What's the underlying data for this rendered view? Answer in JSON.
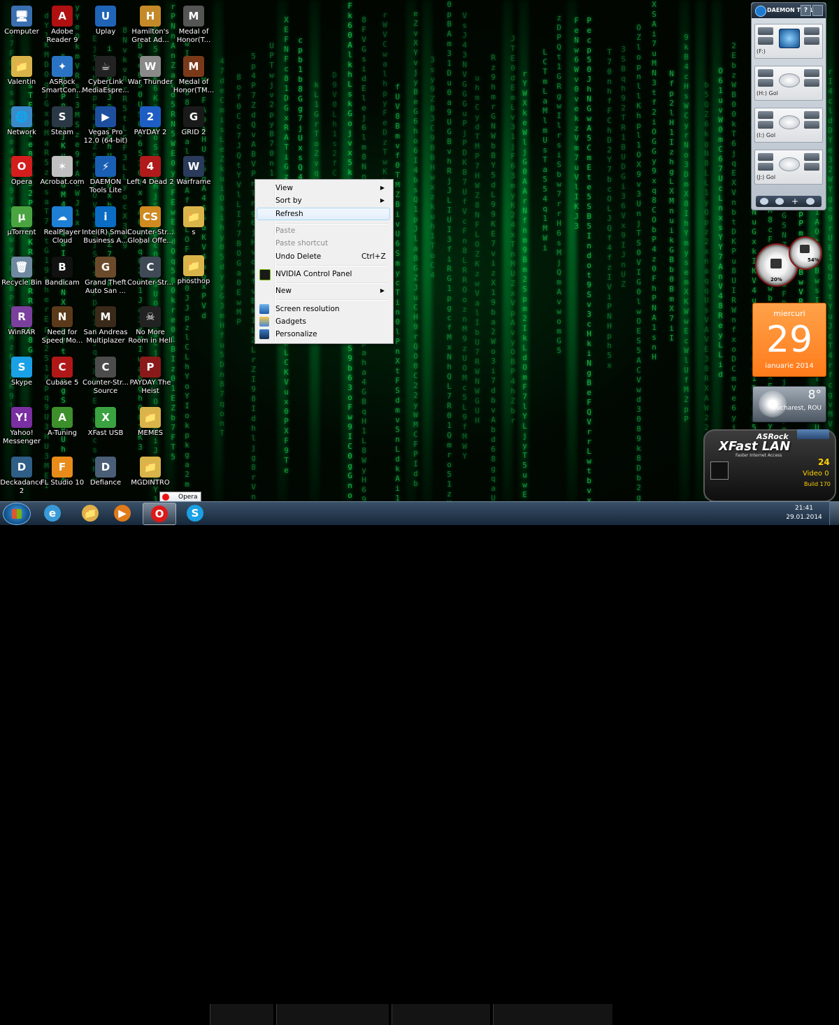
{
  "desktop": {
    "icons": [
      {
        "label": "Computer",
        "glyph": "🖥",
        "color": "#3a6fb0"
      },
      {
        "label": "Valentin",
        "glyph": "📁",
        "color": "#d9b44a"
      },
      {
        "label": "Network",
        "glyph": "🌐",
        "color": "#3a8ac9"
      },
      {
        "label": "Opera",
        "glyph": "O",
        "color": "#d41d1d"
      },
      {
        "label": "µTorrent",
        "glyph": "µ",
        "color": "#4aa540"
      },
      {
        "label": "Recycle Bin",
        "glyph": "🗑",
        "color": "#6f8aa0"
      },
      {
        "label": "WinRAR",
        "glyph": "R",
        "color": "#7b3f9e"
      },
      {
        "label": "Skype",
        "glyph": "S",
        "color": "#1aa0e6"
      },
      {
        "label": "Yahoo! Messenger",
        "glyph": "Y!",
        "color": "#7a2fa2"
      },
      {
        "label": "Deckadance 2",
        "glyph": "D",
        "color": "#2f5e86"
      },
      {
        "label": "Adobe Reader 9",
        "glyph": "A",
        "color": "#b01010"
      },
      {
        "label": "ASRock SmartCon...",
        "glyph": "✦",
        "color": "#2a73c4"
      },
      {
        "label": "Steam",
        "glyph": "S",
        "color": "#2a3745"
      },
      {
        "label": "Acrobat.com",
        "glyph": "✶",
        "color": "#c0c0c0"
      },
      {
        "label": "RealPlayer Cloud",
        "glyph": "☁",
        "color": "#1e7fd4"
      },
      {
        "label": "Bandicam",
        "glyph": "B",
        "color": "#111111"
      },
      {
        "label": "Need for Speed Mo...",
        "glyph": "N",
        "color": "#5a3a1a"
      },
      {
        "label": "Cubase 5",
        "glyph": "C",
        "color": "#b01818"
      },
      {
        "label": "A-Tuning",
        "glyph": "A",
        "color": "#3c8f2a"
      },
      {
        "label": "FL Studio 10",
        "glyph": "F",
        "color": "#e88b1a"
      },
      {
        "label": "Uplay",
        "glyph": "U",
        "color": "#1f64b6"
      },
      {
        "label": "CyberLink MediaEspre...",
        "glyph": "☕",
        "color": "#222222"
      },
      {
        "label": "Vegas Pro 12.0 (64-bit)",
        "glyph": "▶",
        "color": "#1d4f9e"
      },
      {
        "label": "DAEMON Tools Lite",
        "glyph": "⚡",
        "color": "#1a5fb4"
      },
      {
        "label": "Intel(R) Small Business A...",
        "glyph": "i",
        "color": "#0a6cc4"
      },
      {
        "label": "Grand Theft Auto San ...",
        "glyph": "G",
        "color": "#6b4a2b"
      },
      {
        "label": "San Andreas Multiplazer",
        "glyph": "M",
        "color": "#3a2a1a"
      },
      {
        "label": "Counter-Str... Source",
        "glyph": "C",
        "color": "#4c4c4c"
      },
      {
        "label": "XFast USB",
        "glyph": "X",
        "color": "#3aa240"
      },
      {
        "label": "Defiance",
        "glyph": "D",
        "color": "#4a5e78"
      },
      {
        "label": "Hamilton's Great Ad...",
        "glyph": "H",
        "color": "#c48a2a"
      },
      {
        "label": "War Thunder",
        "glyph": "W",
        "color": "#8a8a8a"
      },
      {
        "label": "PAYDAY 2",
        "glyph": "2",
        "color": "#1e5ec4"
      },
      {
        "label": "Left 4 Dead 2",
        "glyph": "4",
        "color": "#b01a1a"
      },
      {
        "label": "Counter-Str... Global Offe...",
        "glyph": "CS",
        "color": "#d08a20"
      },
      {
        "label": "Counter-Str...",
        "glyph": "C",
        "color": "#3f4a56"
      },
      {
        "label": "No More Room in Hell",
        "glyph": "☠",
        "color": "#222222"
      },
      {
        "label": "PAYDAY The Heist",
        "glyph": "P",
        "color": "#8a1a1a"
      },
      {
        "label": "MEMES",
        "glyph": "📁",
        "color": "#d9b44a"
      },
      {
        "label": "MGDINTRO",
        "glyph": "📁",
        "color": "#d9b44a"
      },
      {
        "label": "Medal of Honor(T...",
        "glyph": "M",
        "color": "#555555"
      },
      {
        "label": "Medal of Honor(TM...",
        "glyph": "M",
        "color": "#7a3a1a"
      },
      {
        "label": "GRID 2",
        "glyph": "G",
        "color": "#1a1a1a"
      },
      {
        "label": "Warframe",
        "glyph": "W",
        "color": "#2a3a5a"
      },
      {
        "label": "s",
        "glyph": "📁",
        "color": "#d9b44a"
      },
      {
        "label": "phosthop",
        "glyph": "📁",
        "color": "#d9b44a"
      }
    ]
  },
  "context_menu": {
    "items": {
      "view": "View",
      "sort_by": "Sort by",
      "refresh": "Refresh",
      "paste": "Paste",
      "paste_shortcut": "Paste shortcut",
      "undo_delete": "Undo Delete",
      "undo_shortcut": "Ctrl+Z",
      "nvidia": "NVIDIA Control Panel",
      "new": "New",
      "screen_resolution": "Screen resolution",
      "gadgets": "Gadgets",
      "personalize": "Personalize"
    },
    "submenu_arrow": "▶"
  },
  "daemon_tools": {
    "title": "DAEMON TOOLS",
    "help": "?",
    "drives": [
      {
        "label": "(F:)"
      },
      {
        "label": "(H:) Gol"
      },
      {
        "label": "(I:) Gol"
      },
      {
        "label": "(J:) Gol"
      }
    ]
  },
  "gauges": {
    "cpu": "20%",
    "ram": "54%"
  },
  "calendar": {
    "weekday": "miercuri",
    "day": "29",
    "month_year": "ianuarie 2014"
  },
  "weather": {
    "temp": "8°",
    "city": "Bucharest, ROU"
  },
  "xfast": {
    "brand": "ASRock",
    "name": "XFast LAN",
    "tagline": "Faster Internet Access",
    "count": "24",
    "video": "Video 0",
    "build": "Build 170"
  },
  "taskbar": {
    "tooltip": "Opera",
    "time": "21:41",
    "date": "29.01.2014",
    "apps": [
      {
        "name": "ie",
        "glyph": "e",
        "color": "#3a9ad9"
      },
      {
        "name": "explorer",
        "glyph": "📁",
        "color": "#e0b04a"
      },
      {
        "name": "media-player",
        "glyph": "▶",
        "color": "#e07a1a"
      },
      {
        "name": "opera",
        "glyph": "O",
        "color": "#e01818"
      },
      {
        "name": "skype",
        "glyph": "S",
        "color": "#1aa0e6"
      }
    ]
  },
  "colors": {
    "matrix_green": "#1fbf3f",
    "menu_bg": "#f0f0f0",
    "highlight_border": "#a8d8f4",
    "calendar_orange": "#ff8a2a"
  }
}
